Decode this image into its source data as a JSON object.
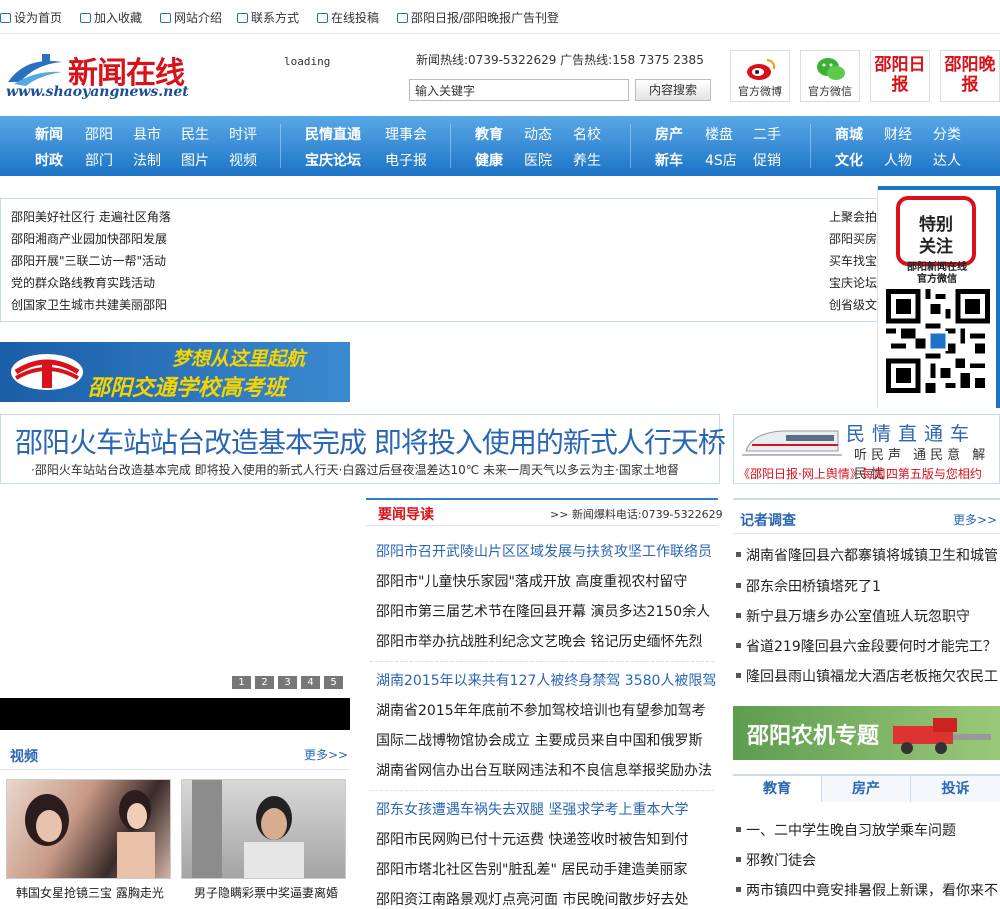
{
  "topbar": {
    "links": [
      "设为首页",
      "加入收藏",
      "网站介绍",
      "联系方式",
      "在线投稿",
      "邵阳日报/邵阳晚报广告刊登"
    ]
  },
  "header": {
    "logo_name": "新闻在线",
    "logo_url": "www.shaoyangnews.net",
    "loading": "loading",
    "hotline": "新闻热线:0739-5322629  广告热线:158 7375 2385",
    "search_placeholder": "输入关键字",
    "search_button": "内容搜索",
    "boxes": [
      {
        "label": "官方微博",
        "icon": "weibo-icon"
      },
      {
        "label": "官方微信",
        "icon": "wechat-icon"
      },
      {
        "label": "邵阳日报",
        "icon": "paper-icon"
      },
      {
        "label": "邵阳晚报",
        "icon": "paper-icon"
      }
    ]
  },
  "nav": {
    "groups": [
      {
        "row1": [
          "新闻",
          "邵阳",
          "县市",
          "民生",
          "时评"
        ],
        "row2": [
          "时政",
          "部门",
          "法制",
          "图片",
          "视频"
        ]
      },
      {
        "row1": [
          "民情直通",
          "理事会"
        ],
        "row2": [
          "宝庆论坛",
          "电子报"
        ]
      },
      {
        "row1": [
          "教育",
          "动态",
          "名校"
        ],
        "row2": [
          "健康",
          "医院",
          "养生"
        ]
      },
      {
        "row1": [
          "房产",
          "楼盘",
          "二手"
        ],
        "row2": [
          "新车",
          "4S店",
          "促销"
        ]
      },
      {
        "row1": [
          "商城",
          "财经",
          "分类"
        ],
        "row2": [
          "文化",
          "人物",
          "达人"
        ]
      }
    ]
  },
  "headlines": {
    "left": [
      "邵阳美好社区行 走遍社区角落",
      "邵阳湘商产业园加快邵阳发展",
      "邵阳开展\"三联二访一帮\"活动",
      "党的群众路线教育实践活动",
      "创国家卫生城市共建美丽邵阳"
    ],
    "right": [
      "上聚会拍",
      "邵阳买房",
      "买车找宝",
      "宝庆论坛",
      "创省级文"
    ]
  },
  "special": {
    "title_line1": "特别",
    "title_line2": "关注",
    "sub_line1": "邵阳新闻在线",
    "sub_line2": "官方微信"
  },
  "banner": {
    "line1": "梦想从这里起航",
    "line2": "邵阳交通学校高考班"
  },
  "bighead": {
    "title": "邵阳火车站站台改造基本完成 即将投入使用的新式人行天桥",
    "marquee": "·邵阳火车站站台改造基本完成 即将投入使用的新式人行天·白露过后昼夜温差达10℃ 未来一周天气以多云为主·国家土地督"
  },
  "mqzt": {
    "title": "民情直通车",
    "sub": "听民声 通民意 解民忧",
    "note": "《邵阳日报·网上舆情》每周四第五版与您相约"
  },
  "slider": {
    "pages": [
      "1",
      "2",
      "3",
      "4",
      "5"
    ]
  },
  "video": {
    "title": "视频",
    "more": "更多>>",
    "items": [
      "韩国女星抢镜三宝 露胸走光",
      "男子隐瞒彩票中奖逼妻离婚"
    ]
  },
  "yaowen": {
    "title": "要闻导读",
    "phone": "新闻爆料电话:0739-5322629",
    "groups": [
      [
        "邵阳市召开武陵山片区区域发展与扶贫攻坚工作联络员",
        "邵阳市\"儿童快乐家园\"落成开放 高度重视农村留守",
        "邵阳市第三届艺术节在隆回县开幕 演员多达2150余人",
        "邵阳市举办抗战胜利纪念文艺晚会 铭记历史缅怀先烈"
      ],
      [
        "湖南2015年以来共有127人被终身禁驾 3580人被限驾",
        "湖南省2015年年底前不参加驾校培训也有望参加驾考",
        "国际二战博物馆协会成立 主要成员来自中国和俄罗斯",
        "湖南省网信办出台互联网违法和不良信息举报奖励办法"
      ],
      [
        "邵东女孩遭遇车祸失去双腿 坚强求学考上重本大学",
        "邵阳市民网购已付十元运费 快递签收时被告知到付",
        "邵阳市塔北社区告别\"脏乱差\" 居民动手建造美丽家",
        "邵阳资江南路景观灯点亮河面 市民晚间散步好去处"
      ]
    ]
  },
  "jizhe": {
    "title": "记者调查",
    "more": "更多>>",
    "items": [
      "湖南省隆回县六都寨镇将城镇卫生和城管",
      "邵东佘田桥镇塔死了1",
      "新宁县万塘乡办公室值班人玩忽职守",
      "省道219隆回县六金段要何时才能完工？",
      "隆回县雨山镇福龙大酒店老板拖欠农民工"
    ]
  },
  "nongji": {
    "title": "邵阳农机专题"
  },
  "tabs": {
    "labels": [
      "教育",
      "房产",
      "投诉"
    ],
    "items": [
      "一、二中学生晚自习放学乘车问题",
      "邪教门徒会",
      "两市镇四中竟安排暑假上新课，看你来不"
    ]
  },
  "colors": {
    "brand_red": "#d8121a",
    "brand_blue": "#1d74c6",
    "link_blue": "#2a66b4"
  }
}
